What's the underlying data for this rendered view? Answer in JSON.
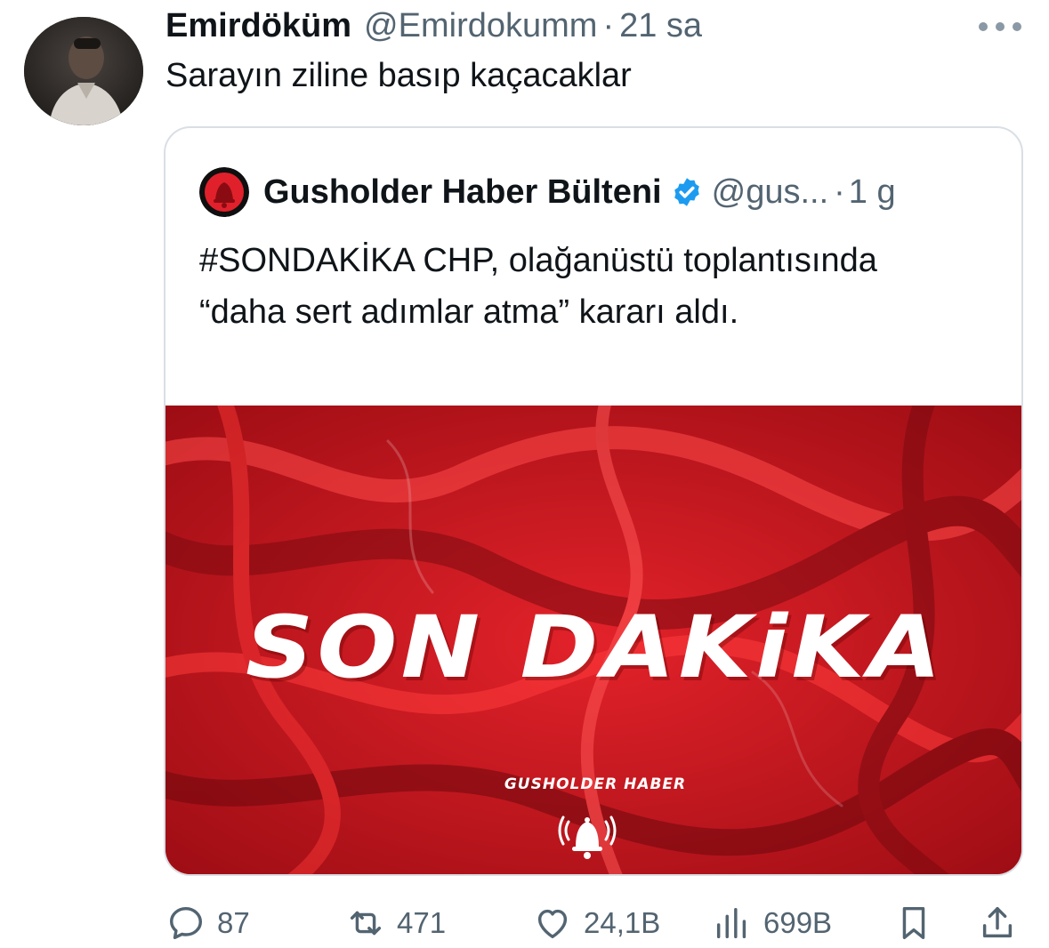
{
  "tweet": {
    "author_name": "Emirdöküm",
    "author_handle": "@Emirdokumm",
    "separator": "·",
    "time": "21 sa",
    "text": "Sarayın ziline basıp kaçacaklar",
    "avatar_icon": "user-avatar-photo",
    "more_icon": "more-options-icon"
  },
  "quoted": {
    "author_name": "Gusholder Haber Bülteni",
    "author_handle": "@gus...",
    "separator": "·",
    "time": "1 g",
    "verified": true,
    "text": "#SONDAKİKA CHP, olağanüstü toplantısında “daha sert adımlar atma” kararı aldı.",
    "media": {
      "headline": "SON DAKiKA",
      "brand": "GUSHOLDER HABER",
      "background_color": "#c8141e",
      "icon": "bell-icon"
    }
  },
  "actions": {
    "replies": "87",
    "retweets": "471",
    "likes": "24,1B",
    "views": "699B"
  },
  "colors": {
    "text_primary": "#0f1419",
    "text_secondary": "#536471",
    "verified_blue": "#1d9bf0",
    "border": "#d9dfe4"
  }
}
